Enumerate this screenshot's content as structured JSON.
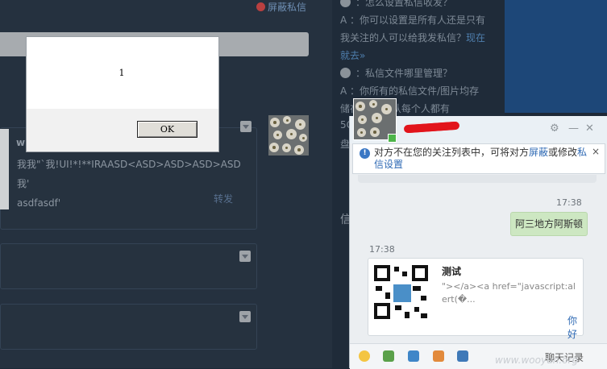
{
  "background_page": {
    "block_link": "屏蔽私信",
    "post": {
      "author": "w",
      "text_line1": "我我\"`我!UI!*!**IRAASD<ASD>ASD>ASD>ASD我'",
      "text_line2": "asdfasdf'",
      "repost": "转发"
    }
  },
  "alert_dialog": {
    "message": "1",
    "ok_label": "OK"
  },
  "faq": {
    "q1_partial": "：怎么设置私信收发？",
    "a1_line1": "A ：你可以设置是所有人还是只有",
    "a1_line2": "我关注的人可以给我发私信？",
    "a1_link_part1": "现在",
    "a1_link_part2": "就去»",
    "q2": "：私信文件哪里管理？",
    "a2_line1": "A ：你所有的私信文件/图片均存",
    "a2_line2": "储在              哦。默认每个人都有",
    "a2_line3": "5G",
    "a2_line4": "盘",
    "side_char": "信"
  },
  "chat_window": {
    "header_icons": [
      "gear-icon",
      "minimize-icon",
      "close-icon"
    ],
    "notice_text_1": "对方不在您的关注列表中，可将对方",
    "notice_link_block": "屏蔽",
    "notice_text_2": "或修改",
    "notice_link_settings": "私信设置",
    "notice_close": "×",
    "ts_1": "17:38",
    "my_message": "阿三地方阿斯顿",
    "ts_2": "17:38",
    "share_title": "测试",
    "share_desc": "\"></a><a href=\"javascript:alert(�...",
    "share_link": "你好",
    "toolbar_icons": [
      "emoji-icon",
      "image-icon",
      "attachment-icon",
      "app-icon",
      "screenshot-icon"
    ],
    "history": "聊天记录"
  },
  "watermark": "www.wooyun.org",
  "colors": {
    "link": "#2f6ab4",
    "bubble_me": "#cde7c2",
    "redaction": "#e2141b",
    "page_dim": "#25313f"
  }
}
